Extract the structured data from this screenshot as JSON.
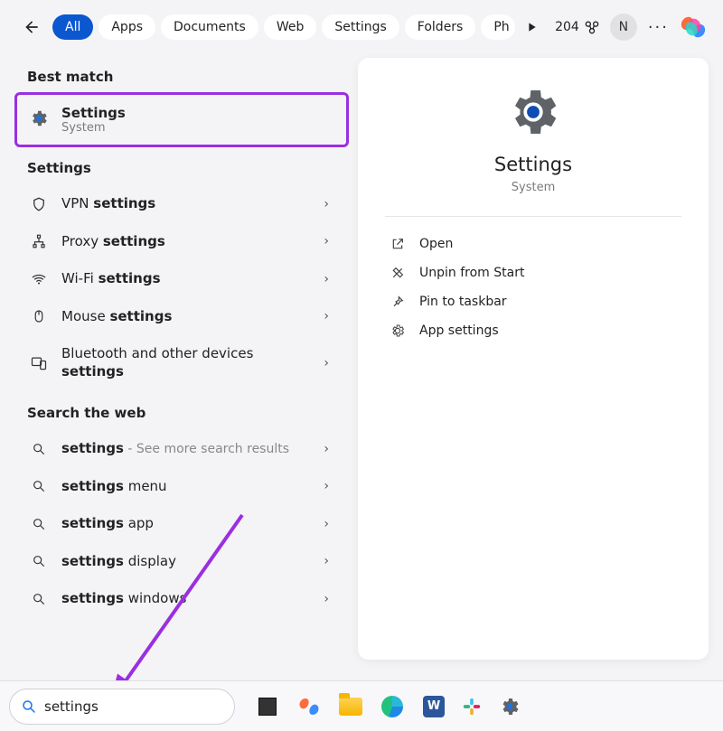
{
  "topbar": {
    "filters": [
      "All",
      "Apps",
      "Documents",
      "Web",
      "Settings",
      "Folders",
      "Ph"
    ],
    "active_filter_index": 0,
    "points": "204",
    "avatar_initial": "N"
  },
  "left": {
    "best_match_header": "Best match",
    "best_match": {
      "title": "Settings",
      "subtitle": "System"
    },
    "settings_header": "Settings",
    "settings_items": [
      {
        "pre": "VPN ",
        "bold": "settings",
        "post": ""
      },
      {
        "pre": "Proxy ",
        "bold": "settings",
        "post": ""
      },
      {
        "pre": "Wi-Fi ",
        "bold": "settings",
        "post": ""
      },
      {
        "pre": "Mouse ",
        "bold": "settings",
        "post": ""
      },
      {
        "pre": "Bluetooth and other devices ",
        "bold": "settings",
        "post": ""
      }
    ],
    "web_header": "Search the web",
    "web_items": [
      {
        "pre": "",
        "bold": "settings",
        "post": "",
        "hint": " - See more search results"
      },
      {
        "pre": "",
        "bold": "settings",
        "post": " menu"
      },
      {
        "pre": "",
        "bold": "settings",
        "post": " app"
      },
      {
        "pre": "",
        "bold": "settings",
        "post": " display"
      },
      {
        "pre": "",
        "bold": "settings",
        "post": " windows"
      }
    ]
  },
  "preview": {
    "title": "Settings",
    "subtitle": "System",
    "actions": [
      "Open",
      "Unpin from Start",
      "Pin to taskbar",
      "App settings"
    ]
  },
  "taskbar": {
    "search_value": "settings"
  }
}
